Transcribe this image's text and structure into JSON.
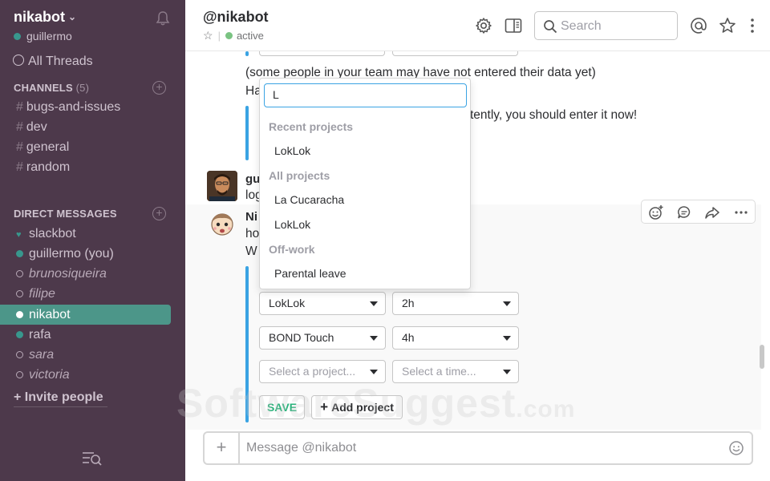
{
  "sidebar": {
    "team_name": "nikabot",
    "current_user": "guillermo",
    "all_threads": "All Threads",
    "channels_header": "CHANNELS",
    "channels_count": "(5)",
    "channels": [
      "bugs-and-issues",
      "dev",
      "general",
      "random"
    ],
    "dm_header": "DIRECT MESSAGES",
    "dms": [
      {
        "name": "slackbot",
        "status": "bot"
      },
      {
        "name": "guillermo (you)",
        "status": "online"
      },
      {
        "name": "brunosiqueira",
        "status": "away"
      },
      {
        "name": "filipe",
        "status": "away"
      },
      {
        "name": "nikabot",
        "status": "active"
      },
      {
        "name": "rafa",
        "status": "online"
      },
      {
        "name": "sara",
        "status": "away"
      },
      {
        "name": "victoria",
        "status": "away"
      }
    ],
    "invite": "+ Invite people"
  },
  "header": {
    "title": "@nikabot",
    "status": "active",
    "search_placeholder": "Search",
    "icons": [
      "gear-icon",
      "sidebar-toggle-icon",
      "search-icon",
      "at-sign-icon",
      "star-icon",
      "more-vertical-icon"
    ]
  },
  "messages": {
    "line1": "(some people in your team may have not entered their data yet)",
    "line2_prefix": "Ha",
    "line3_suffix": "tently, you should enter it now!",
    "user2_initial": "gu",
    "user2_text": "log",
    "user3_initial": "Ni",
    "user3_line1": "ho",
    "user3_line2": "W"
  },
  "dropdown": {
    "query": "L",
    "groups": [
      {
        "label": "Recent projects",
        "options": [
          "LokLok"
        ]
      },
      {
        "label": "All projects",
        "options": [
          "La Cucaracha",
          "LokLok"
        ]
      },
      {
        "label": "Off-work",
        "options": [
          "Parental leave"
        ]
      }
    ]
  },
  "form": {
    "rows": [
      {
        "project": "LokLok",
        "time": "2h"
      },
      {
        "project": "BOND Touch",
        "time": "4h"
      },
      {
        "project": "Select a project...",
        "time": "Select a time..."
      }
    ],
    "save": "SAVE",
    "add_project": "Add project"
  },
  "composer": {
    "placeholder": "Message @nikabot"
  },
  "watermark": {
    "text": "SoftwareSuggest",
    "suffix": ".com"
  },
  "colors": {
    "sidebar_bg": "#4d394b",
    "active_item": "#4c9689",
    "presence": "#38978d",
    "attachment_bar": "#3aa3e3",
    "save_green": "#2ab27b"
  }
}
